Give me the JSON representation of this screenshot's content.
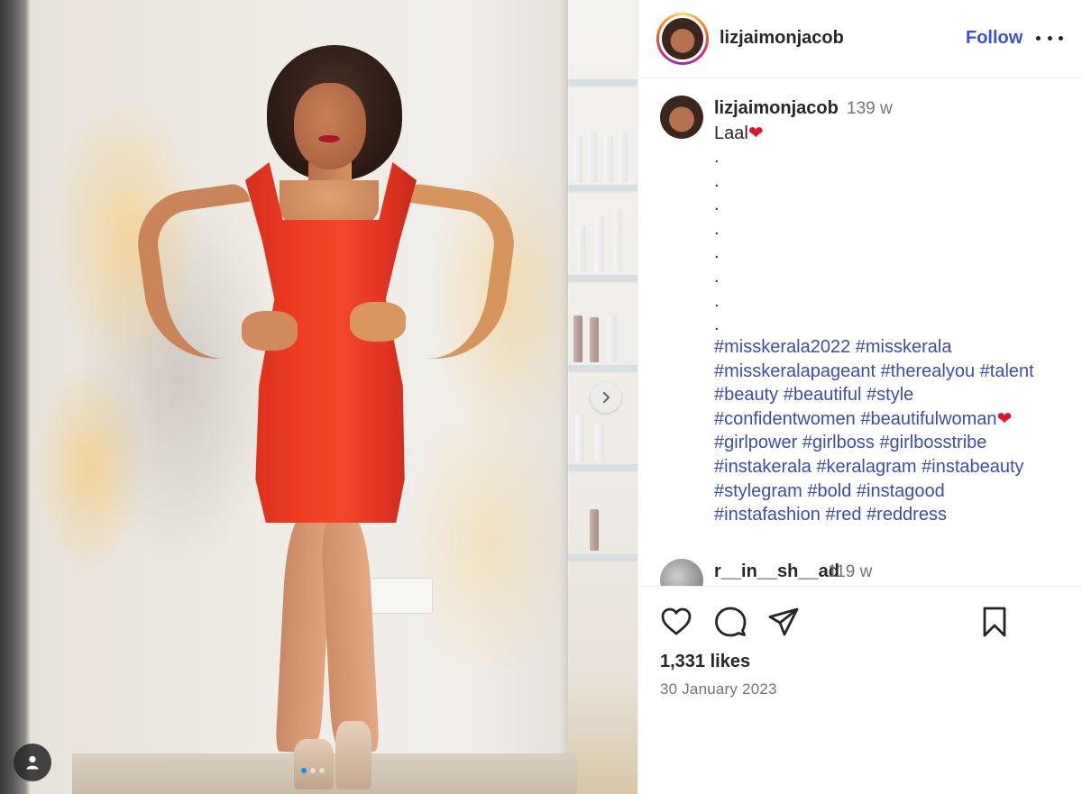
{
  "post": {
    "username": "lizjaimonjacob",
    "follow_label": "Follow",
    "caption": {
      "username": "lizjaimonjacob",
      "time": "139 w",
      "text": "Laal",
      "text_emoji": "❤",
      "dot_lines": [
        ".",
        ".",
        ".",
        ".",
        ".",
        ".",
        ".",
        "."
      ],
      "hashtag_lines": [
        [
          "#misskerala2022",
          "#misskerala"
        ],
        [
          "#misskeralapageant",
          "#therealyou",
          "#talent"
        ],
        [
          "#beauty",
          "#beautiful",
          "#style"
        ],
        [
          "#confidentwomen",
          "#beautifulwoman"
        ],
        [
          "#girlpower",
          "#girlboss",
          "#girlbosstribe"
        ],
        [
          "#instakerala",
          "#keralagram",
          "#instabeauty"
        ],
        [
          "#stylegram",
          "#bold",
          "#instagood"
        ],
        [
          "#instafashion",
          "#red",
          "#reddress"
        ]
      ],
      "hashtag_line_emoji": {
        "3": "❤"
      }
    },
    "next_comment": {
      "username": "r__in__sh__ad",
      "time": "119 w"
    },
    "likes": "1,331 likes",
    "date": "30 January 2023",
    "carousel": {
      "count": 3,
      "active": 0
    }
  },
  "icons": {
    "more": "more-options-icon",
    "next": "chevron-right-icon",
    "tag": "user-tag-icon",
    "like": "heart-icon",
    "comment": "comment-icon",
    "share": "share-icon",
    "save": "bookmark-icon"
  },
  "colors": {
    "link": "#3d4edc",
    "hashtag": "#3d4ea8",
    "muted": "#737373",
    "text": "#262626",
    "carousel_active": "#0095f6"
  }
}
